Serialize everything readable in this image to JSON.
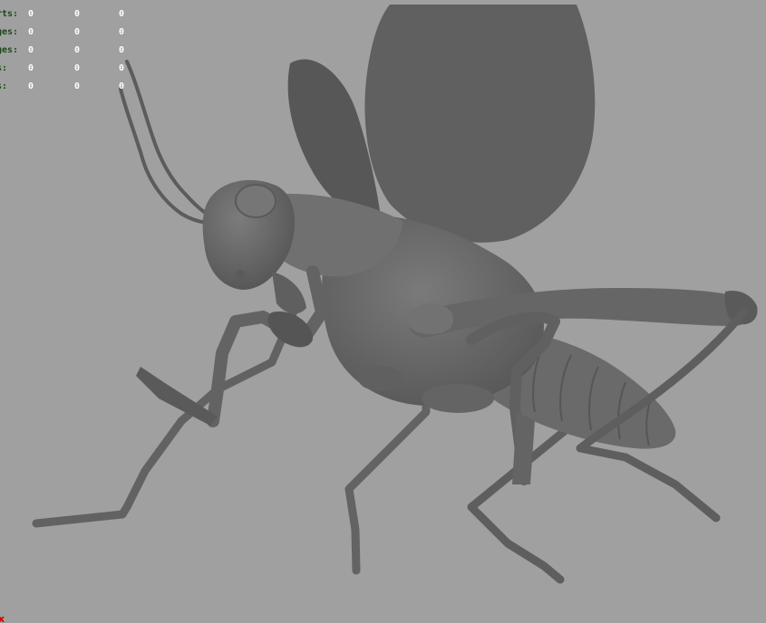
{
  "hud": {
    "rows": [
      {
        "label": "rts:",
        "values": [
          "0",
          "0",
          "0"
        ]
      },
      {
        "label": "ges:",
        "values": [
          "0",
          "0",
          "0"
        ]
      },
      {
        "label": "ges:",
        "values": [
          "0",
          "0",
          "0"
        ]
      },
      {
        "label": "s:",
        "values": [
          "0",
          "0",
          "0"
        ]
      },
      {
        "label": "s:",
        "values": [
          "0",
          "0",
          "0"
        ]
      }
    ]
  },
  "axis_indicator": {
    "label": "x",
    "color": "#cc0000"
  },
  "colors": {
    "background": "#a0a0a0",
    "model_body": "#6b6b6b",
    "wing": "#5d5d5d"
  }
}
